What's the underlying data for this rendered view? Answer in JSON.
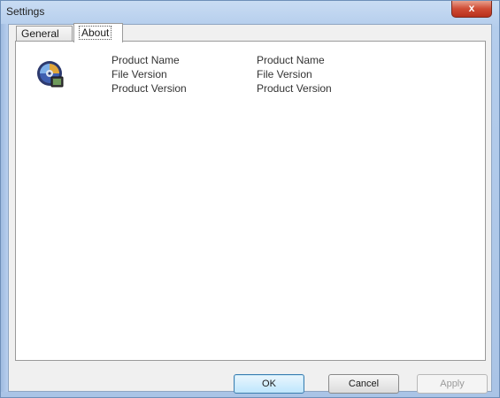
{
  "window": {
    "title": "Settings",
    "close_label": "x"
  },
  "tabs": [
    {
      "label": "General",
      "selected": false
    },
    {
      "label": "About",
      "selected": true
    }
  ],
  "about": {
    "icon": "disc-app-icon",
    "labels": [
      "Product Name",
      "File Version",
      "Product Version"
    ],
    "values": [
      "Product Name",
      "File Version",
      "Product Version"
    ]
  },
  "buttons": {
    "ok": "OK",
    "cancel": "Cancel",
    "apply": "Apply"
  },
  "colors": {
    "title_bar": "#b4cdec",
    "close_button": "#cf4b34",
    "default_button": "#bee6fd"
  }
}
